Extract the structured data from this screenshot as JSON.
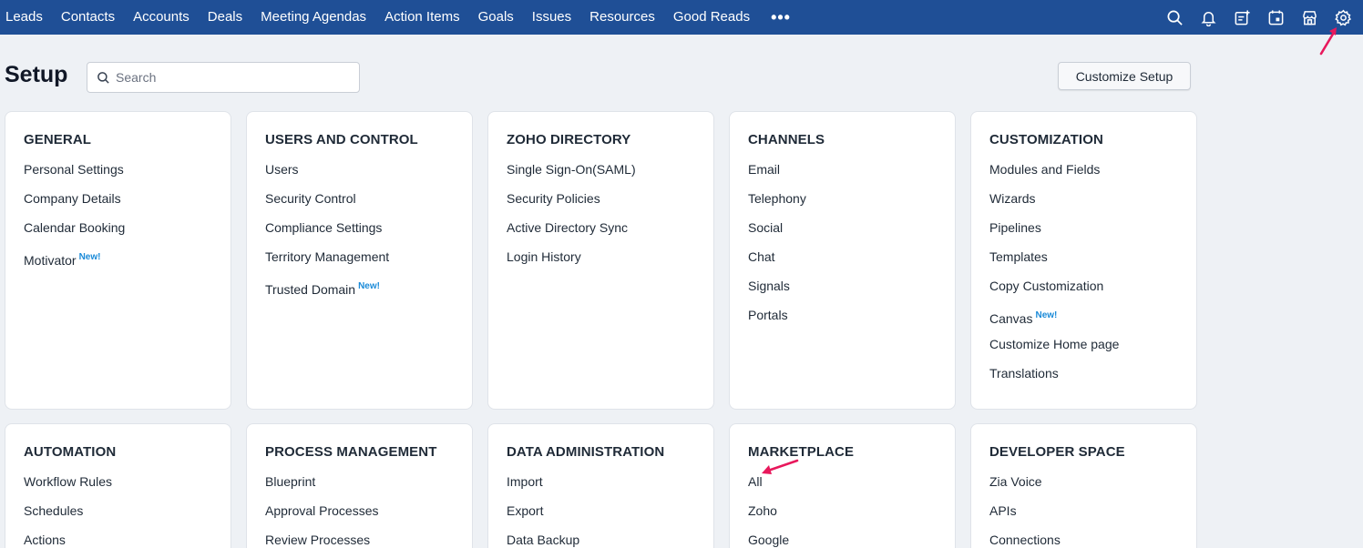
{
  "nav": {
    "items": [
      "Leads",
      "Contacts",
      "Accounts",
      "Deals",
      "Meeting Agendas",
      "Action Items",
      "Goals",
      "Issues",
      "Resources",
      "Good Reads"
    ],
    "more": "•••"
  },
  "page": {
    "title": "Setup"
  },
  "search": {
    "placeholder": "Search"
  },
  "customize_button": "Customize Setup",
  "new_label": "New!",
  "cards": {
    "general": {
      "title": "GENERAL",
      "links": [
        "Personal Settings",
        "Company Details",
        "Calendar Booking",
        "Motivator"
      ]
    },
    "users": {
      "title": "USERS AND CONTROL",
      "links": [
        "Users",
        "Security Control",
        "Compliance Settings",
        "Territory Management",
        "Trusted Domain"
      ]
    },
    "directory": {
      "title": "ZOHO DIRECTORY",
      "links": [
        "Single Sign-On(SAML)",
        "Security Policies",
        "Active Directory Sync",
        "Login History"
      ]
    },
    "channels": {
      "title": "CHANNELS",
      "links": [
        "Email",
        "Telephony",
        "Social",
        "Chat",
        "Signals",
        "Portals"
      ]
    },
    "customization": {
      "title": "CUSTOMIZATION",
      "links": [
        "Modules and Fields",
        "Wizards",
        "Pipelines",
        "Templates",
        "Copy Customization",
        "Canvas",
        "Customize Home page",
        "Translations"
      ]
    },
    "automation": {
      "title": "AUTOMATION",
      "links": [
        "Workflow Rules",
        "Schedules",
        "Actions"
      ]
    },
    "process": {
      "title": "PROCESS MANAGEMENT",
      "links": [
        "Blueprint",
        "Approval Processes",
        "Review Processes"
      ]
    },
    "data_admin": {
      "title": "DATA ADMINISTRATION",
      "links": [
        "Import",
        "Export",
        "Data Backup"
      ]
    },
    "marketplace": {
      "title": "MARKETPLACE",
      "links": [
        "All",
        "Zoho",
        "Google"
      ]
    },
    "developer": {
      "title": "DEVELOPER SPACE",
      "links": [
        "Zia Voice",
        "APIs",
        "Connections"
      ]
    }
  },
  "colors": {
    "nav_bg": "#1f4f96",
    "new_badge": "#1a8ad8",
    "annotation_arrow": "#e8185c"
  }
}
